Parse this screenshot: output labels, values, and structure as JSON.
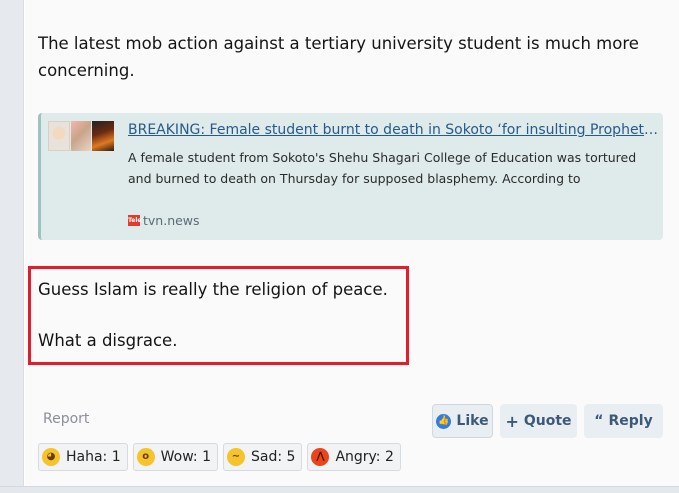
{
  "post": {
    "intro_text": "The latest mob action against a tertiary university student is much more concerning.",
    "highlighted_lines": [
      "Guess Islam is really the religion of peace.",
      "What a disgrace."
    ]
  },
  "link_preview": {
    "title": "BREAKING: Female student burnt to death in Sokoto ‘for insulting Prophet Muhammad’",
    "description": "A female student from Sokoto's Shehu Shagari College of Education was tortured and burned to death on Thursday for supposed blasphemy. According to",
    "source_domain": "tvn.news",
    "favicon_text": "Tele"
  },
  "actions": {
    "report_label": "Report",
    "like_label": "Like",
    "quote_label": "Quote",
    "reply_label": "Reply"
  },
  "reactions": [
    {
      "label": "Haha: 1",
      "icon": "laughing-emoji-icon"
    },
    {
      "label": "Wow: 1",
      "icon": "surprised-emoji-icon"
    },
    {
      "label": "Sad: 5",
      "icon": "sad-emoji-icon"
    },
    {
      "label": "Angry: 2",
      "icon": "angry-emoji-icon"
    }
  ],
  "colors": {
    "highlight_border": "#e01e2e",
    "link": "#275a8a",
    "preview_bg": "#dfeaea"
  }
}
